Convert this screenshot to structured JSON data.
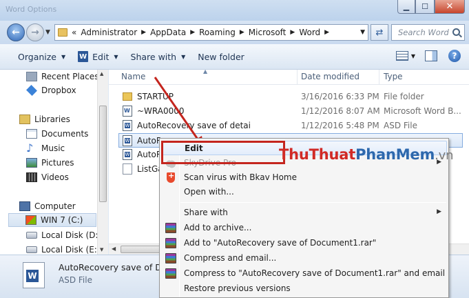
{
  "window": {
    "title": "Word Options"
  },
  "address": {
    "prefix": "«",
    "crumbs": [
      "Administrator",
      "AppData",
      "Roaming",
      "Microsoft",
      "Word"
    ],
    "search_placeholder": "Search Word"
  },
  "toolbar": {
    "organize": "Organize",
    "edit": "Edit",
    "share_with": "Share with",
    "new_folder": "New folder"
  },
  "nav": {
    "recent": "Recent Places",
    "dropbox": "Dropbox",
    "libraries": "Libraries",
    "documents": "Documents",
    "music": "Music",
    "pictures": "Pictures",
    "videos": "Videos",
    "computer": "Computer",
    "win7": "WIN 7 (C:)",
    "disk_d": "Local Disk (D:)",
    "disk_e": "Local Disk (E:)"
  },
  "columns": {
    "name": "Name",
    "date": "Date modified",
    "type": "Type"
  },
  "files": [
    {
      "name": "STARTUP",
      "date": "3/16/2016 6:33 PM",
      "type": "File folder"
    },
    {
      "name": "~WRA0000",
      "date": "1/12/2016 8:07 AM",
      "type": "Microsoft Word B..."
    },
    {
      "name": "AutoRecovery save of detai",
      "date": "1/12/2016 5:48 PM",
      "type": "ASD File"
    },
    {
      "name": "AutoR",
      "date": "",
      "type": ""
    },
    {
      "name": "AutoR",
      "date": "",
      "type": ""
    },
    {
      "name": "ListGal",
      "date": "",
      "type": ""
    }
  ],
  "details": {
    "name": "AutoRecovery save of Do",
    "type": "ASD File"
  },
  "menu": {
    "edit": "Edit",
    "skydrive": "SkyDrive Pro",
    "scan": "Scan virus with Bkav Home",
    "open_with": "Open with...",
    "share_with": "Share with",
    "add_archive": "Add to archive...",
    "add_rar": "Add to \"AutoRecovery save of Document1.rar\"",
    "compress_email": "Compress and email...",
    "compress_rar_email": "Compress to \"AutoRecovery save of Document1.rar\" and email",
    "restore": "Restore previous versions"
  },
  "watermark": {
    "part1": "ThuThuat",
    "part2": "PhanMem",
    "part3": ".vn"
  },
  "colors": {
    "highlight": "#c4251e",
    "accent": "#2d68ad"
  }
}
